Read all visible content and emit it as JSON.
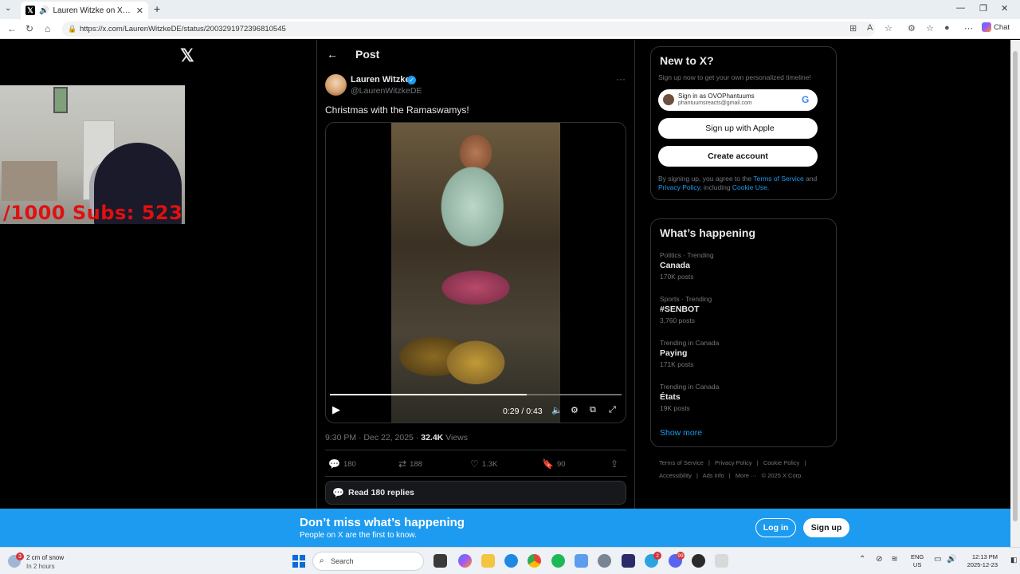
{
  "browser": {
    "tab_title": "Lauren Witzke on X: \"Christm",
    "url": "https://x.com/LaurenWitzkeDE/status/2003291972396810545",
    "chat_label": "Chat"
  },
  "webcam": {
    "overlay_text": "/1000  Subs: 523"
  },
  "post": {
    "header_title": "Post",
    "author_name": "Lauren Witzke",
    "author_handle": "@LaurenWitzkeDE",
    "text": "Christmas with the Ramaswamys!",
    "video": {
      "current_time": "0:29 / 0:43",
      "progress": 0.674
    },
    "timestamp": "9:30 PM · Dec 22, 2025 · ",
    "views_count": "32.4K",
    "views_label": " Views",
    "stats": {
      "replies": "180",
      "reposts": "188",
      "likes": "1.3K",
      "bookmarks": "90"
    },
    "read_replies_label": "Read 180 replies"
  },
  "signup_panel": {
    "title": "New to X?",
    "subtitle": "Sign up now to get your own personalized timeline!",
    "google_line1": "Sign in as OVOPhantuums",
    "google_line2": "phantuumsreacts@gmail.com",
    "apple_label": "Sign up with Apple",
    "create_label": "Create account",
    "legal_prefix": "By signing up, you agree to the ",
    "terms_link": "Terms of Service",
    "legal_and": " and ",
    "privacy_link": "Privacy Policy",
    "legal_including": ", including ",
    "cookie_link": "Cookie Use."
  },
  "happening": {
    "title": "What’s happening",
    "trends": [
      {
        "context": "Politics · Trending",
        "name": "Canada",
        "count": "170K posts"
      },
      {
        "context": "Sports · Trending",
        "name": "#SENBOT",
        "count": "3,760 posts"
      },
      {
        "context": "Trending in Canada",
        "name": "Paying",
        "count": "171K posts"
      },
      {
        "context": "Trending in Canada",
        "name": "États",
        "count": "19K posts"
      }
    ],
    "show_more": "Show more"
  },
  "footer_links": [
    "Terms of Service",
    "|",
    "Privacy Policy",
    "|",
    "Cookie Policy",
    "|",
    "Accessibility",
    "|",
    "Ads info",
    "|",
    "More ···",
    "© 2025 X Corp."
  ],
  "banner": {
    "title": "Don’t miss what’s happening",
    "subtitle": "People on X are the first to know.",
    "login_label": "Log in",
    "signup_label": "Sign up"
  },
  "taskbar": {
    "weather_line1": "2 cm of snow",
    "weather_line2": "In 2 hours",
    "weather_badge": "3",
    "search_placeholder": "Search",
    "lang_line1": "ENG",
    "lang_line2": "US",
    "time": "12:13 PM",
    "date": "2025-12-23",
    "telegram_badge": "2",
    "discord_badge": "99"
  },
  "colors": {
    "accent": "#1d9bf0",
    "background": "#000000",
    "border": "#2f3336",
    "muted_text": "#71767b"
  }
}
